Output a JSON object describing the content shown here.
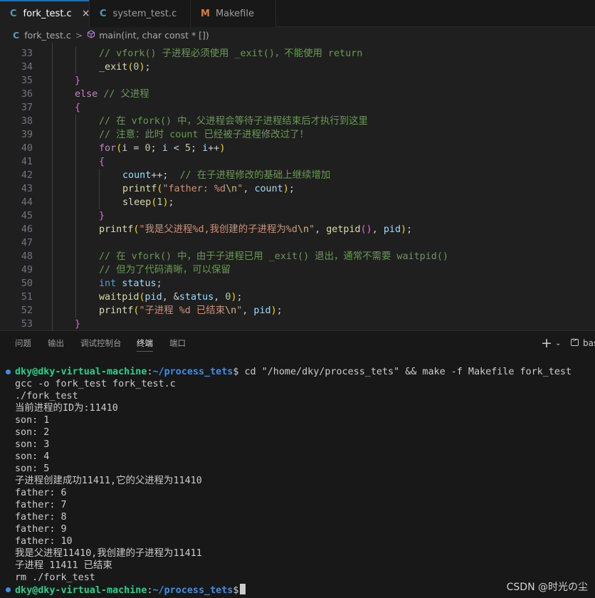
{
  "tabs": [
    {
      "icon": "C",
      "label": "fork_test.c",
      "active": true,
      "close": "×"
    },
    {
      "icon": "C",
      "label": "system_test.c",
      "active": false
    },
    {
      "icon": "M",
      "label": "Makefile",
      "active": false
    }
  ],
  "breadcrumb": {
    "file_icon": "C",
    "file": "fork_test.c",
    "separator": ">",
    "symbol": "main(int, char const * [])"
  },
  "editor": {
    "lines": [
      {
        "n": "33",
        "indent": 2,
        "tokens": [
          {
            "t": "// vfork() 子进程必须使用 _exit()，不能使用 return",
            "c": "comment"
          }
        ]
      },
      {
        "n": "34",
        "indent": 2,
        "tokens": [
          {
            "t": "_exit",
            "c": "fn"
          },
          {
            "t": "(",
            "c": "paren"
          },
          {
            "t": "0",
            "c": "num"
          },
          {
            "t": ")",
            "c": "paren"
          },
          {
            "t": ";",
            "c": "plain"
          }
        ]
      },
      {
        "n": "35",
        "indent": 1,
        "tokens": [
          {
            "t": "}",
            "c": "brace"
          }
        ]
      },
      {
        "n": "36",
        "indent": 1,
        "tokens": [
          {
            "t": "else",
            "c": "kw"
          },
          {
            "t": " ",
            "c": "plain"
          },
          {
            "t": "// 父进程",
            "c": "comment"
          }
        ]
      },
      {
        "n": "37",
        "indent": 1,
        "tokens": [
          {
            "t": "{",
            "c": "brace"
          }
        ]
      },
      {
        "n": "38",
        "indent": 2,
        "tokens": [
          {
            "t": "// 在 vfork() 中，父进程会等待子进程结束后才执行到这里",
            "c": "comment"
          }
        ]
      },
      {
        "n": "39",
        "indent": 2,
        "tokens": [
          {
            "t": "// 注意：此时 count 已经被子进程修改过了！",
            "c": "comment"
          }
        ]
      },
      {
        "n": "40",
        "indent": 2,
        "tokens": [
          {
            "t": "for",
            "c": "kw"
          },
          {
            "t": "(",
            "c": "paren"
          },
          {
            "t": "i",
            "c": "var"
          },
          {
            "t": " = ",
            "c": "plain"
          },
          {
            "t": "0",
            "c": "num"
          },
          {
            "t": "; ",
            "c": "plain"
          },
          {
            "t": "i",
            "c": "var"
          },
          {
            "t": " < ",
            "c": "plain"
          },
          {
            "t": "5",
            "c": "num"
          },
          {
            "t": "; ",
            "c": "plain"
          },
          {
            "t": "i",
            "c": "var"
          },
          {
            "t": "++",
            "c": "plain"
          },
          {
            "t": ")",
            "c": "paren"
          }
        ]
      },
      {
        "n": "41",
        "indent": 2,
        "tokens": [
          {
            "t": "{",
            "c": "brace"
          }
        ]
      },
      {
        "n": "42",
        "indent": 3,
        "tokens": [
          {
            "t": "count",
            "c": "var"
          },
          {
            "t": "++;  ",
            "c": "plain"
          },
          {
            "t": "// 在子进程修改的基础上继续增加",
            "c": "comment"
          }
        ]
      },
      {
        "n": "43",
        "indent": 3,
        "tokens": [
          {
            "t": "printf",
            "c": "fn"
          },
          {
            "t": "(",
            "c": "paren"
          },
          {
            "t": "\"father: %d",
            "c": "str"
          },
          {
            "t": "\\n",
            "c": "esc"
          },
          {
            "t": "\"",
            "c": "str"
          },
          {
            "t": ", ",
            "c": "plain"
          },
          {
            "t": "count",
            "c": "var"
          },
          {
            "t": ")",
            "c": "paren"
          },
          {
            "t": ";",
            "c": "plain"
          }
        ]
      },
      {
        "n": "44",
        "indent": 3,
        "tokens": [
          {
            "t": "sleep",
            "c": "fn"
          },
          {
            "t": "(",
            "c": "paren"
          },
          {
            "t": "1",
            "c": "num"
          },
          {
            "t": ")",
            "c": "paren"
          },
          {
            "t": ";",
            "c": "plain"
          }
        ]
      },
      {
        "n": "45",
        "indent": 2,
        "tokens": [
          {
            "t": "}",
            "c": "brace"
          }
        ]
      },
      {
        "n": "46",
        "indent": 2,
        "tokens": [
          {
            "t": "printf",
            "c": "fn"
          },
          {
            "t": "(",
            "c": "paren"
          },
          {
            "t": "\"我是父进程%d,我创建的子进程为%d",
            "c": "str"
          },
          {
            "t": "\\n",
            "c": "esc"
          },
          {
            "t": "\"",
            "c": "str"
          },
          {
            "t": ", ",
            "c": "plain"
          },
          {
            "t": "getpid",
            "c": "fn"
          },
          {
            "t": "()",
            "c": "brace"
          },
          {
            "t": ", ",
            "c": "plain"
          },
          {
            "t": "pid",
            "c": "var"
          },
          {
            "t": ")",
            "c": "paren"
          },
          {
            "t": ";",
            "c": "plain"
          }
        ]
      },
      {
        "n": "47",
        "indent": 2,
        "tokens": []
      },
      {
        "n": "48",
        "indent": 2,
        "tokens": [
          {
            "t": "// 在 vfork() 中，由于子进程已用 _exit() 退出，通常不需要 waitpid()",
            "c": "comment"
          }
        ]
      },
      {
        "n": "49",
        "indent": 2,
        "tokens": [
          {
            "t": "// 但为了代码清晰，可以保留",
            "c": "comment"
          }
        ]
      },
      {
        "n": "50",
        "indent": 2,
        "tokens": [
          {
            "t": "int",
            "c": "type"
          },
          {
            "t": " ",
            "c": "plain"
          },
          {
            "t": "status",
            "c": "var"
          },
          {
            "t": ";",
            "c": "plain"
          }
        ]
      },
      {
        "n": "51",
        "indent": 2,
        "tokens": [
          {
            "t": "waitpid",
            "c": "fn"
          },
          {
            "t": "(",
            "c": "paren"
          },
          {
            "t": "pid",
            "c": "var"
          },
          {
            "t": ", &",
            "c": "plain"
          },
          {
            "t": "status",
            "c": "var"
          },
          {
            "t": ", ",
            "c": "plain"
          },
          {
            "t": "0",
            "c": "num"
          },
          {
            "t": ")",
            "c": "paren"
          },
          {
            "t": ";",
            "c": "plain"
          }
        ]
      },
      {
        "n": "52",
        "indent": 2,
        "tokens": [
          {
            "t": "printf",
            "c": "fn"
          },
          {
            "t": "(",
            "c": "paren"
          },
          {
            "t": "\"子进程 %d 已结束",
            "c": "str"
          },
          {
            "t": "\\n",
            "c": "esc"
          },
          {
            "t": "\"",
            "c": "str"
          },
          {
            "t": ", ",
            "c": "plain"
          },
          {
            "t": "pid",
            "c": "var"
          },
          {
            "t": ")",
            "c": "paren"
          },
          {
            "t": ";",
            "c": "plain"
          }
        ]
      },
      {
        "n": "53",
        "indent": 1,
        "tokens": [
          {
            "t": "}",
            "c": "brace"
          }
        ]
      }
    ]
  },
  "panel": {
    "tabs": [
      {
        "label": "问题",
        "active": false
      },
      {
        "label": "输出",
        "active": false
      },
      {
        "label": "调试控制台",
        "active": false
      },
      {
        "label": "终端",
        "active": true
      },
      {
        "label": "端口",
        "active": false
      }
    ],
    "new_terminal": "+",
    "dropdown": "⌄",
    "terminal_name": "bas"
  },
  "terminal": {
    "prompt_user": "dky@dky-virtual-machine",
    "prompt_sep": ":",
    "prompt_path": "~/process_tets",
    "prompt_symbol": "$",
    "command": " cd \"/home/dky/process_tets\" && make -f Makefile fork_test",
    "output": [
      "gcc -o fork_test fork_test.c",
      "./fork_test",
      "当前进程的ID为:11410",
      "son: 1",
      "son: 2",
      "son: 3",
      "son: 4",
      "son: 5",
      "子进程创建成功11411,它的父进程为11410",
      "father: 6",
      "father: 7",
      "father: 8",
      "father: 9",
      "father: 10",
      "我是父进程11410,我创建的子进程为11411",
      "子进程 11411 已结束",
      "rm ./fork_test"
    ]
  },
  "watermark": "CSDN @时光の尘"
}
